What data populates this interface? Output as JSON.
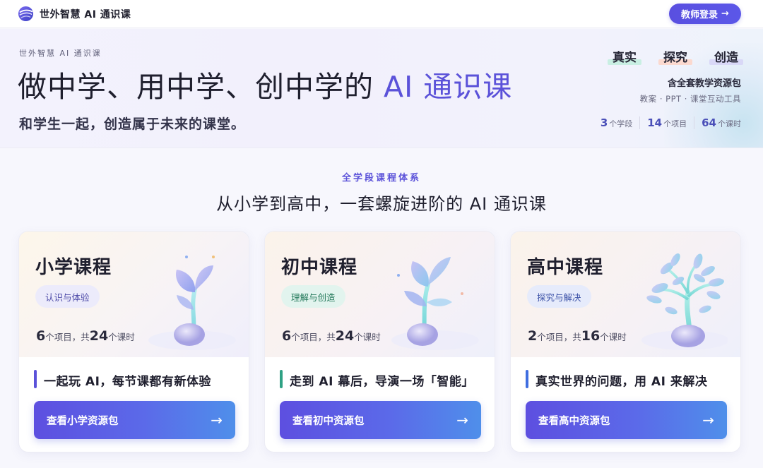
{
  "header": {
    "brand_name": "世外智慧 AI 通识课",
    "login_label": "教师登录",
    "login_arrow": "→"
  },
  "hero": {
    "kicker": "世外智慧 AI 通识课",
    "title_main": "做中学、用中学、创中学的 ",
    "title_accent": "AI 通识课",
    "subtitle": "和学生一起，创造属于未来的课堂。",
    "tags": [
      {
        "label": "真实",
        "color": "#c9efe3"
      },
      {
        "label": "探究",
        "color": "#fbd9cf"
      },
      {
        "label": "创造",
        "color": "#d9d8f7"
      }
    ],
    "pack_title": "含全套教学资源包",
    "pack_items": "教案 · PPT · 课堂互动工具",
    "stats": [
      {
        "num": "3",
        "unit": "个学段"
      },
      {
        "num": "14",
        "unit": "个项目"
      },
      {
        "num": "64",
        "unit": "个课时"
      }
    ]
  },
  "section": {
    "kicker": "全学段课程体系",
    "title": "从小学到高中，一套螺旋进阶的 AI 通识课"
  },
  "cards": [
    {
      "title": "小学课程",
      "badge": "认识与体验",
      "projects": "6",
      "projects_unit": "个项目，共",
      "hours": "24",
      "hours_unit": "个课时",
      "tagline": "一起玩 AI，每节课都有新体验",
      "button": "查看小学资源包",
      "arrow": "→",
      "top_bg": "#fbf4ea",
      "badge_bg": "#ecebfb",
      "badge_color": "#4d4aa8",
      "bar_color": "#5b52d9"
    },
    {
      "title": "初中课程",
      "badge": "理解与创造",
      "projects": "6",
      "projects_unit": "个项目，共",
      "hours": "24",
      "hours_unit": "个课时",
      "tagline": "走到 AI 幕后，导演一场「智能」",
      "button": "查看初中资源包",
      "arrow": "→",
      "top_bg": "#f8f1f3",
      "badge_bg": "#e2f4ee",
      "badge_color": "#257a5c",
      "bar_color": "#2fa184"
    },
    {
      "title": "高中课程",
      "badge": "探究与解决",
      "projects": "2",
      "projects_unit": "个项目，共",
      "hours": "16",
      "hours_unit": "个课时",
      "tagline": "真实世界的问题，用 AI 来解决",
      "button": "查看高中资源包",
      "arrow": "→",
      "top_bg": "#f8f1f3",
      "badge_bg": "#e6ebfb",
      "badge_color": "#3d53a8",
      "bar_color": "#3f6ee0"
    }
  ]
}
